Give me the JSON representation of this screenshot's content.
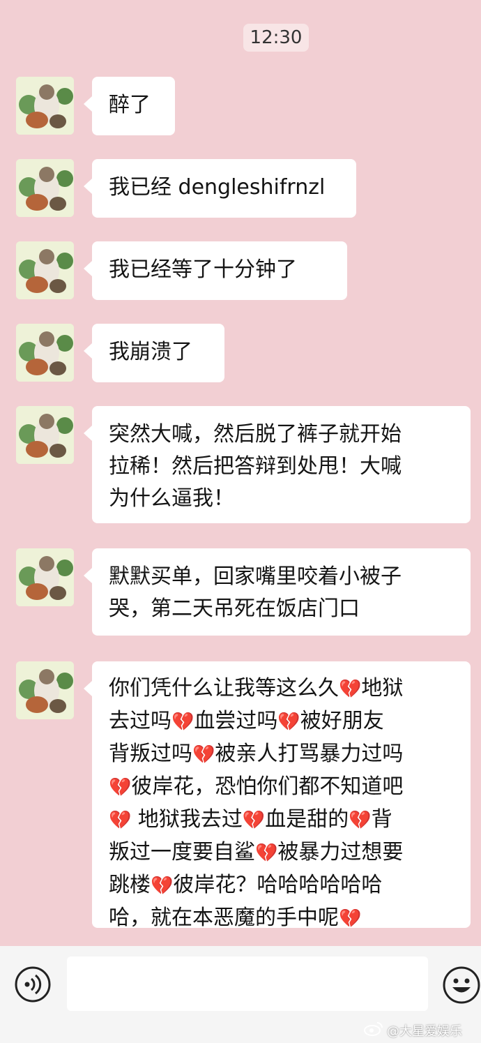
{
  "time_stamp": "12:30",
  "messages": [
    {
      "text": "醉了"
    },
    {
      "text": "我已经 dengleshifrnzl"
    },
    {
      "text": "我已经等了十分钟了"
    },
    {
      "text": "我崩溃了"
    },
    {
      "lines": [
        "突然大喊，然后脱了裤子就开始",
        "拉稀！然后把答辩到处甩！大喊",
        "为什么逼我！"
      ]
    },
    {
      "lines": [
        "默默买单，回家嘴里咬着小被子",
        "哭，第二天吊死在饭店门口"
      ]
    },
    {
      "segments": [
        [
          "你们凭什么让我等这么久",
          "地狱"
        ],
        [
          "去过吗",
          "血尝过吗",
          "被好朋友"
        ],
        [
          "背叛过吗",
          "被亲人打骂暴力过吗"
        ],
        [
          "",
          "彼岸花，恐怕你们都不知道吧"
        ],
        [
          "",
          " 地狱我去过",
          "血是甜的",
          "背"
        ],
        [
          "叛过一度要自鲨",
          "被暴力过想要"
        ],
        [
          "跳楼",
          "彼岸花？哈哈哈哈哈哈"
        ],
        [
          "哈，就在本恶魔的手中呢",
          ""
        ]
      ]
    }
  ],
  "heart_glyph": "💔",
  "input": {
    "value": "",
    "placeholder": ""
  },
  "icons": {
    "voice": "voice-icon",
    "emoji": "emoji-icon",
    "avatar": "avatar-cat"
  },
  "watermark": "@大星爱娱乐",
  "colors": {
    "background": "#f2cfd3",
    "bubble": "#ffffff",
    "heart": "#c41c2b"
  }
}
